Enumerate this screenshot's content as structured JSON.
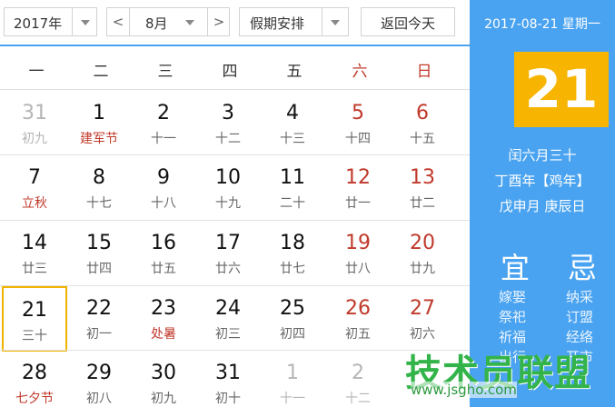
{
  "toolbar": {
    "year": "2017年",
    "month": "8月",
    "holiday": "假期安排",
    "prev": "<",
    "next": ">",
    "back_today": "返回今天"
  },
  "weekdays": [
    "一",
    "二",
    "三",
    "四",
    "五",
    "六",
    "日"
  ],
  "weeks": [
    [
      {
        "day": "31",
        "sub": "初九",
        "other": true
      },
      {
        "day": "1",
        "sub": "建军节",
        "festival": true
      },
      {
        "day": "2",
        "sub": "十一"
      },
      {
        "day": "3",
        "sub": "十二"
      },
      {
        "day": "4",
        "sub": "十三"
      },
      {
        "day": "5",
        "sub": "十四"
      },
      {
        "day": "6",
        "sub": "十五"
      }
    ],
    [
      {
        "day": "7",
        "sub": "立秋",
        "festival": true
      },
      {
        "day": "8",
        "sub": "十七"
      },
      {
        "day": "9",
        "sub": "十八"
      },
      {
        "day": "10",
        "sub": "十九"
      },
      {
        "day": "11",
        "sub": "二十"
      },
      {
        "day": "12",
        "sub": "廿一"
      },
      {
        "day": "13",
        "sub": "廿二"
      }
    ],
    [
      {
        "day": "14",
        "sub": "廿三"
      },
      {
        "day": "15",
        "sub": "廿四"
      },
      {
        "day": "16",
        "sub": "廿五"
      },
      {
        "day": "17",
        "sub": "廿六"
      },
      {
        "day": "18",
        "sub": "廿七"
      },
      {
        "day": "19",
        "sub": "廿八"
      },
      {
        "day": "20",
        "sub": "廿九"
      }
    ],
    [
      {
        "day": "21",
        "sub": "三十",
        "today": true
      },
      {
        "day": "22",
        "sub": "初一"
      },
      {
        "day": "23",
        "sub": "处暑",
        "festival": true
      },
      {
        "day": "24",
        "sub": "初三"
      },
      {
        "day": "25",
        "sub": "初四"
      },
      {
        "day": "26",
        "sub": "初五"
      },
      {
        "day": "27",
        "sub": "初六"
      }
    ],
    [
      {
        "day": "28",
        "sub": "七夕节",
        "festival": true
      },
      {
        "day": "29",
        "sub": "初八"
      },
      {
        "day": "30",
        "sub": "初九"
      },
      {
        "day": "31",
        "sub": "初十"
      },
      {
        "day": "1",
        "sub": "十一",
        "other": true
      },
      {
        "day": "2",
        "sub": "十二",
        "other": true
      },
      {
        "day": "",
        "sub": "",
        "other": true
      }
    ]
  ],
  "panel": {
    "date_line": "2017-08-21 星期一",
    "big_day": "21",
    "lunar": "闰六月三十",
    "ganzhi_year": "丁酉年【鸡年】",
    "ganzhi_day": "戊申月 庚辰日",
    "yi": "宜",
    "ji": "忌",
    "yi_items": [
      "嫁娶",
      "祭祀",
      "祈福",
      "出行"
    ],
    "ji_items": [
      "纳采",
      "订盟",
      "经络",
      "开市"
    ]
  },
  "watermark": {
    "title": "技术员联盟",
    "url": "www.jsgho.com"
  },
  "colors": {
    "accent": "#4aa3f0",
    "today_badge": "#f7b400",
    "weekend": "#c0392b",
    "watermark": "#33b44a"
  }
}
